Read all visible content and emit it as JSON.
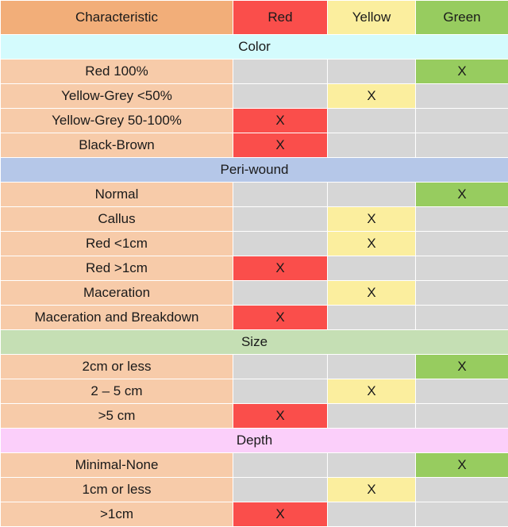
{
  "table": {
    "columns": [
      {
        "key": "characteristic",
        "label": "Characteristic",
        "color": "#f2ae79"
      },
      {
        "key": "red",
        "label": "Red",
        "color": "#fa4e4b"
      },
      {
        "key": "yellow",
        "label": "Yellow",
        "color": "#fbee9e"
      },
      {
        "key": "green",
        "label": "Green",
        "color": "#97cc5f"
      }
    ],
    "mark": "X",
    "sections": [
      {
        "title": "Color",
        "band_color": "#d4fbfd",
        "rows": [
          {
            "label": "Red 100%",
            "red": false,
            "yellow": false,
            "green": true
          },
          {
            "label": "Yellow-Grey <50%",
            "red": false,
            "yellow": true,
            "green": false
          },
          {
            "label": "Yellow-Grey 50-100%",
            "red": true,
            "yellow": false,
            "green": false
          },
          {
            "label": "Black-Brown",
            "red": true,
            "yellow": false,
            "green": false
          }
        ]
      },
      {
        "title": "Peri-wound",
        "band_color": "#b5c7e8",
        "rows": [
          {
            "label": "Normal",
            "red": false,
            "yellow": false,
            "green": true
          },
          {
            "label": "Callus",
            "red": false,
            "yellow": true,
            "green": false
          },
          {
            "label": "Red  <1cm",
            "red": false,
            "yellow": true,
            "green": false
          },
          {
            "label": "Red  >1cm",
            "red": true,
            "yellow": false,
            "green": false
          },
          {
            "label": "Maceration",
            "red": false,
            "yellow": true,
            "green": false
          },
          {
            "label": "Maceration and Breakdown",
            "red": true,
            "yellow": false,
            "green": false
          }
        ]
      },
      {
        "title": "Size",
        "band_color": "#c5dfb4",
        "rows": [
          {
            "label": "2cm or less",
            "red": false,
            "yellow": false,
            "green": true
          },
          {
            "label": "2 – 5 cm",
            "red": false,
            "yellow": true,
            "green": false
          },
          {
            "label": ">5 cm",
            "red": true,
            "yellow": false,
            "green": false
          }
        ]
      },
      {
        "title": "Depth",
        "band_color": "#fbcffa",
        "rows": [
          {
            "label": "Minimal-None",
            "red": false,
            "yellow": false,
            "green": true
          },
          {
            "label": "1cm or less",
            "red": false,
            "yellow": true,
            "green": false
          },
          {
            "label": ">1cm",
            "red": true,
            "yellow": false,
            "green": false
          }
        ]
      }
    ]
  }
}
